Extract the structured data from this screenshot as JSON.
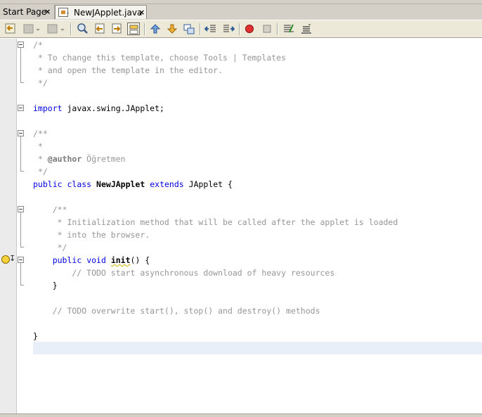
{
  "tabs": [
    {
      "label": "Start Page",
      "close": "×",
      "active": false
    },
    {
      "label": "NewJApplet.java",
      "close": "×",
      "active": true
    }
  ],
  "toolbar_icons": [
    "back-icon",
    "forward-icon",
    "forward-dropdown-icon",
    "last-edit-icon",
    "last-edit-dropdown-icon",
    "find-icon",
    "find-previous-icon",
    "find-next-icon",
    "toggle-highlight-icon",
    "previous-bookmark-icon",
    "next-bookmark-icon",
    "toggle-bookmark-icon",
    "shift-left-icon",
    "shift-right-icon",
    "record-macro-icon",
    "stop-macro-icon",
    "comment-icon",
    "uncomment-icon"
  ],
  "colors": {
    "keyword": "#0000e6",
    "comment": "#969696",
    "current_line": "#e9eff8",
    "gutter": "#ebebeb"
  },
  "code": {
    "l1": "/*",
    "l2": " * To change this template, choose Tools | Templates",
    "l3": " * and open the template in the editor.",
    "l4": " */",
    "l6_kw": "import",
    "l6_rest": " javax.swing.JApplet;",
    "l8": "/**",
    "l9": " *",
    "l10_pre": " * ",
    "l10_tag": "@author",
    "l10_rest": " Öğretmen",
    "l11": " */",
    "l12_kw1": "public",
    "l12_kw2": "class",
    "l12_name": "NewJApplet",
    "l12_kw3": "extends",
    "l12_rest": "JApplet {",
    "l14": "    /**",
    "l15": "     * Initialization method that will be called after the applet is loaded",
    "l16": "     * into the browser.",
    "l17": "     */",
    "l18_kw1": "public",
    "l18_kw2": "void",
    "l18_name": "init",
    "l18_rest": "() {",
    "l19": "        // TODO start asynchronous download of heavy resources",
    "l20": "    }",
    "l22": "    // TODO overwrite start(), stop() and destroy() methods",
    "l24": "}"
  }
}
